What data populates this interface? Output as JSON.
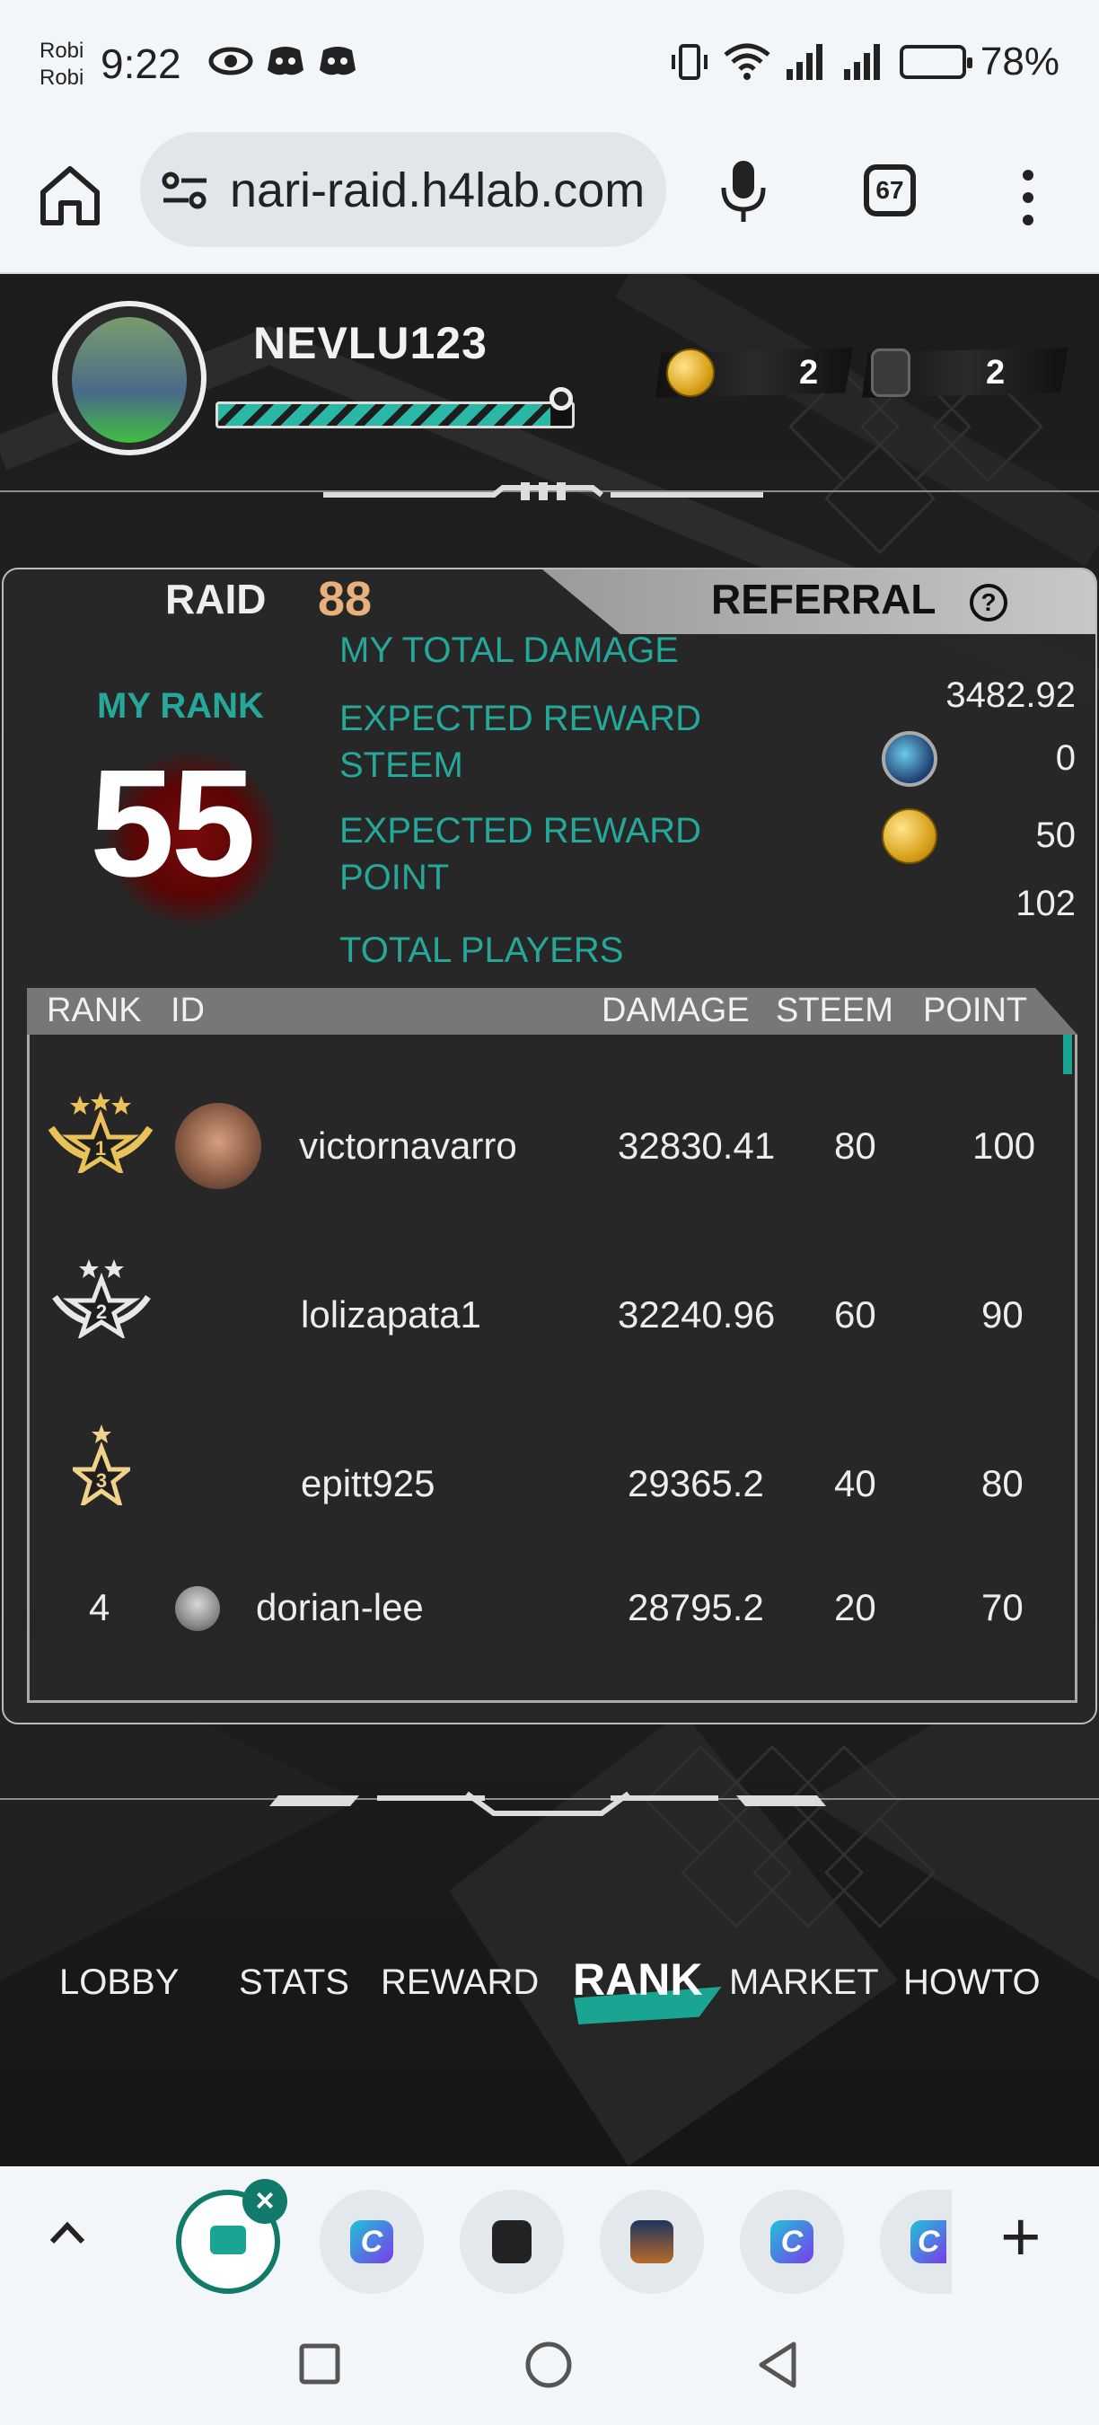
{
  "status_bar": {
    "carrier_1": "Robi",
    "carrier_2": "Robi",
    "time": "9:22",
    "battery": "78%"
  },
  "browser": {
    "url": "nari-raid.h4lab.com",
    "tab_count": "67"
  },
  "profile": {
    "username": "NEVLU123",
    "coins": "2",
    "tickets": "2"
  },
  "panel": {
    "tab_raid": "RAID",
    "raid_number": "88",
    "tab_referral": "REFERRAL",
    "help_symbol": "?",
    "my_rank_label": "MY RANK",
    "my_rank": "55",
    "stats": {
      "total_damage_label": "MY TOTAL DAMAGE",
      "total_damage": "3482.92",
      "reward_steem_label_1": "EXPECTED REWARD",
      "reward_steem_label_2": "STEEM",
      "reward_steem": "0",
      "reward_point_label_1": "EXPECTED REWARD",
      "reward_point_label_2": "POINT",
      "reward_point": "50",
      "total_players_label": "TOTAL PLAYERS",
      "total_players": "102"
    }
  },
  "table": {
    "headers": {
      "rank": "RANK",
      "id": "ID",
      "damage": "DAMAGE",
      "steem": "STEEM",
      "point": "POINT"
    },
    "rows": [
      {
        "rank": "1",
        "id": "victornavarro",
        "damage": "32830.41",
        "steem": "80",
        "point": "100"
      },
      {
        "rank": "2",
        "id": "lolizapata1",
        "damage": "32240.96",
        "steem": "60",
        "point": "90"
      },
      {
        "rank": "3",
        "id": "epitt925",
        "damage": "29365.2",
        "steem": "40",
        "point": "80"
      },
      {
        "rank": "4",
        "id": "dorian-lee",
        "damage": "28795.2",
        "steem": "20",
        "point": "70"
      }
    ]
  },
  "nav": {
    "lobby": "LOBBY",
    "stats": "STATS",
    "reward": "REWARD",
    "rank": "RANK",
    "market": "MARKET",
    "howto": "HOWTO"
  },
  "colors": {
    "accent_teal": "#25a89a",
    "raid_number": "#e8b07a",
    "panel_bg": "#282828"
  }
}
